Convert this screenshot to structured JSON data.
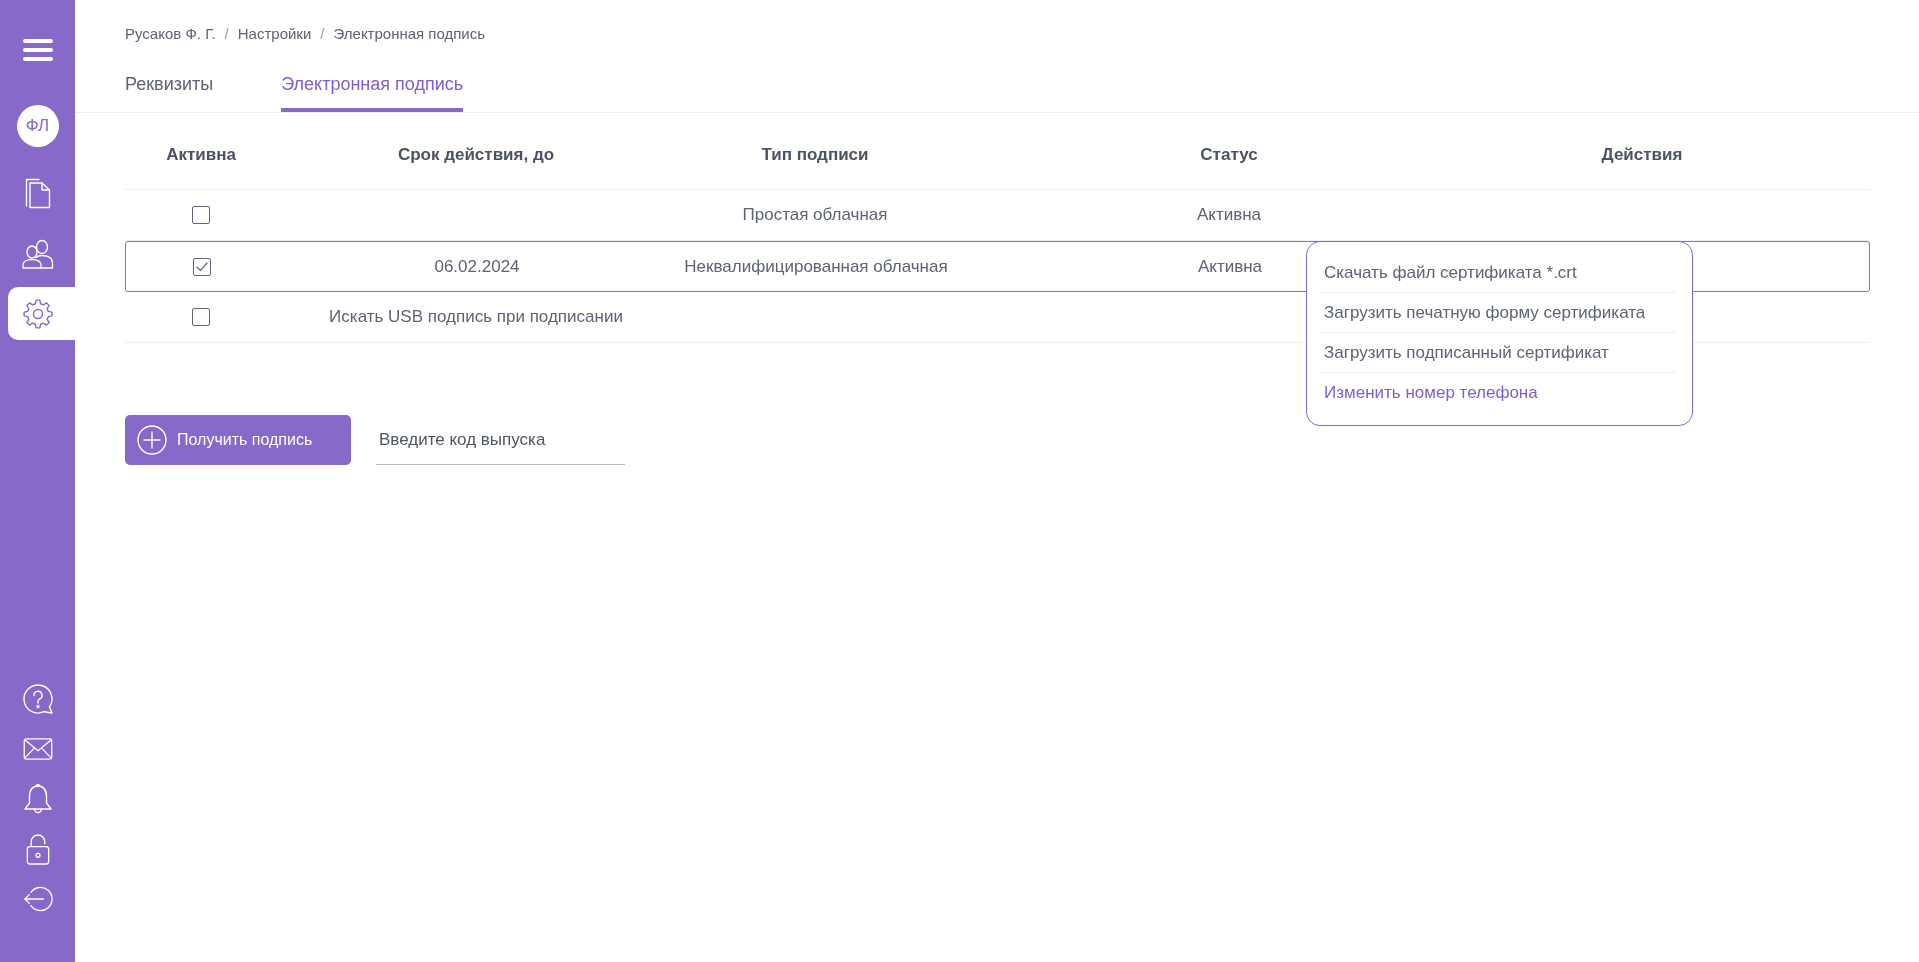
{
  "sidebar": {
    "avatar_initials": "ФЛ",
    "nav_items": [
      {
        "selected": false
      },
      {
        "selected": false
      },
      {
        "selected": true
      }
    ]
  },
  "breadcrumb": {
    "items": [
      "Русаков Ф. Г.",
      "Настройки",
      "Электронная подпись"
    ],
    "separator": "/"
  },
  "tabs": [
    {
      "label": "Реквизиты",
      "selected": false
    },
    {
      "label": "Электронная подпись",
      "selected": true
    }
  ],
  "table": {
    "columns": [
      "Активна",
      "Срок действия, до",
      "Тип подписи",
      "Статус",
      "Действия"
    ],
    "rows": [
      {
        "checked": false,
        "type": "Простая облачная",
        "status": "Активна",
        "selected": false
      },
      {
        "checked": true,
        "valid_until": "06.02.2024",
        "type": "Неквалифицированная облачная",
        "status": "Активна",
        "selected": true
      },
      {
        "checked": false,
        "note": "Искать USB подпись при подписании",
        "selected": false
      }
    ]
  },
  "context_menu": {
    "items": [
      {
        "label": "Скачать файл сертификата *.crt",
        "kind": "action"
      },
      {
        "label": "Загрузить печатную форму сертификата",
        "kind": "action"
      },
      {
        "label": "Загрузить подписанный сертификат",
        "kind": "action"
      },
      {
        "label": "Изменить номер телефона",
        "kind": "link"
      }
    ]
  },
  "get_signature_button": {
    "label": "Получить подпись"
  },
  "release_code_field": {
    "placeholder": "Введите код выпуска"
  }
}
